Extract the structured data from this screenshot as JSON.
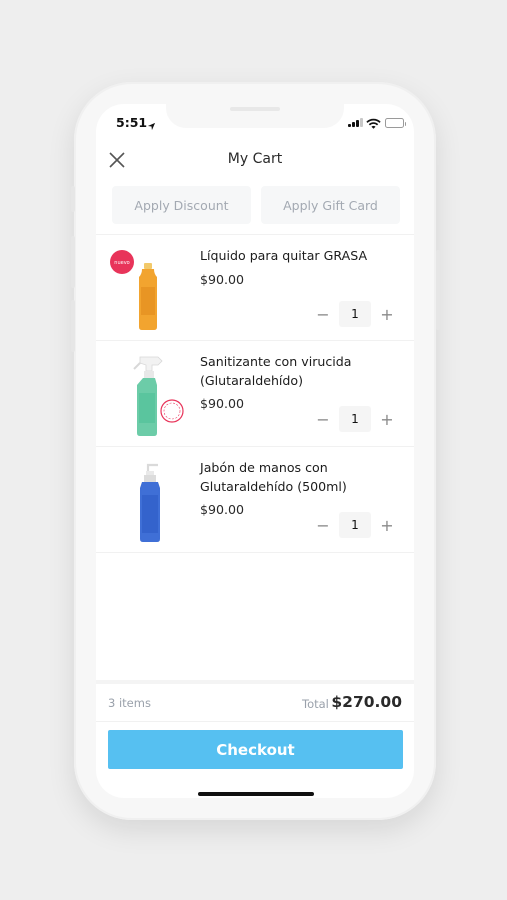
{
  "status_bar": {
    "time": "5:51"
  },
  "header": {
    "title": "My Cart"
  },
  "actions": {
    "discount_label": "Apply Discount",
    "gift_card_label": "Apply Gift Card"
  },
  "cart": {
    "items": [
      {
        "name": "Líquido para quitar GRASA",
        "price": "$90.00",
        "quantity": "1",
        "image": "orange-bottle",
        "badge": "nuevo"
      },
      {
        "name": "Sanitizante con virucida (Glutaraldehído)",
        "price": "$90.00",
        "quantity": "1",
        "image": "green-spray-bottle"
      },
      {
        "name": "Jabón de manos con Glutaraldehído (500ml)",
        "price": "$90.00",
        "quantity": "1",
        "image": "blue-pump-bottle"
      }
    ]
  },
  "summary": {
    "items_count": "3 items",
    "total_label": "Total",
    "total_value": "$270.00"
  },
  "checkout": {
    "label": "Checkout"
  },
  "colors": {
    "accent": "#56c0f1",
    "badge": "#e8345a"
  }
}
